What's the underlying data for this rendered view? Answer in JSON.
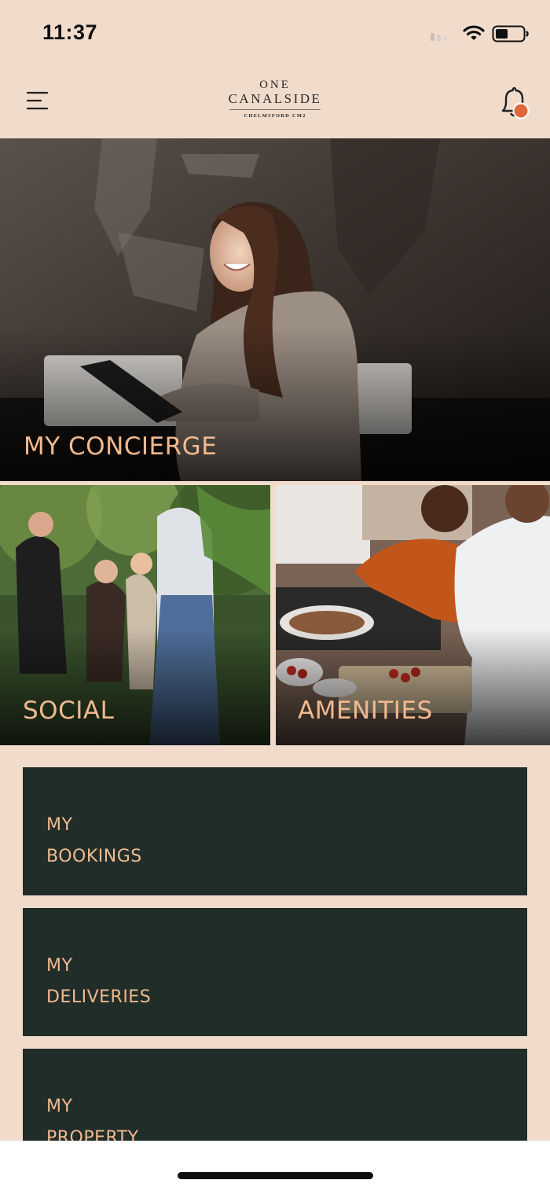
{
  "status_bar": {
    "time": "11:37"
  },
  "header": {
    "logo": {
      "line1": "ONE",
      "line2": "CANALSIDE",
      "line3": "CHELMSFORD CM2"
    },
    "menu_icon": "menu-icon",
    "notification_icon": "bell-icon",
    "notification_dot_color": "#e0673a"
  },
  "tiles": {
    "concierge": {
      "label": "MY CONCIERGE"
    },
    "social": {
      "label": "SOCIAL"
    },
    "amenities": {
      "label": "AMENITIES"
    }
  },
  "cards": {
    "bookings": {
      "line1": "MY",
      "line2": "BOOKINGS"
    },
    "deliveries": {
      "line1": "MY",
      "line2": "DELIVERIES"
    },
    "property": {
      "line1": "MY",
      "line2": "PROPERTY"
    }
  },
  "colors": {
    "background": "#f1dccb",
    "accent_text": "#f0b98f",
    "card_background": "#212d29"
  }
}
